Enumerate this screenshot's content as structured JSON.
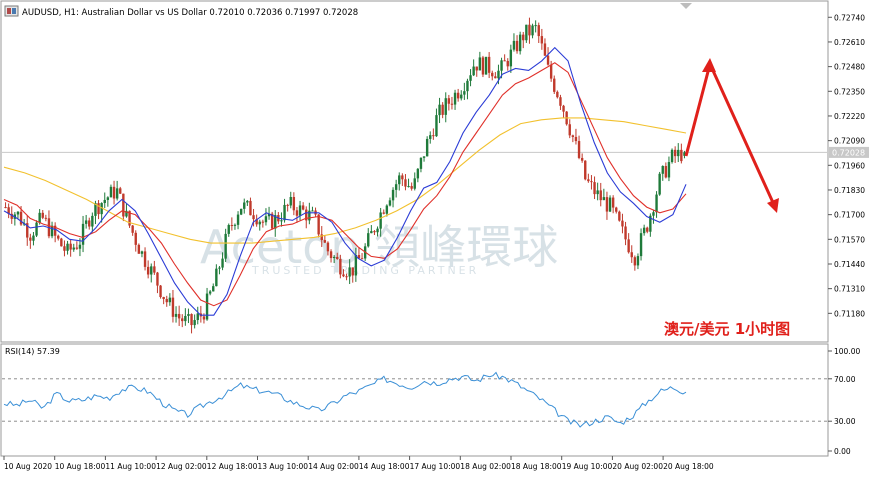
{
  "header": {
    "symbol_line": "AUDUSD, H1:  Australian Dollar vs US Dollar  0.72010 0.72036 0.71997 0.72028"
  },
  "colors": {
    "bull": "#1f7a3a",
    "bear": "#c0392b",
    "ma_fast": "#2b3cd6",
    "ma_mid": "#e0302a",
    "ma_slow": "#f2c12e",
    "rsi": "#3a8fd6",
    "arrow": "#e0201b",
    "grid": "#7f7f7f",
    "text": "#000000"
  },
  "icons": {
    "window_icon": "chart-window-icon",
    "scroll_marker": "scroll-triangle-icon"
  },
  "overlay": {
    "watermark": "Acetop 領峰環球",
    "watermark_sub": "TRUSTED TRADING PARTNER",
    "annotation": "澳元/美元 1小时图"
  },
  "chart_data": [
    {
      "type": "candlestick",
      "symbol": "AUDUSD",
      "timeframe": "H1",
      "description": "Australian Dollar vs US Dollar",
      "last_bar": {
        "open": 0.7201,
        "high": 0.72036,
        "low": 0.71997,
        "close": 0.72028
      },
      "current_price_label": "0.72028",
      "ylim": [
        0.7105,
        0.7281
      ],
      "y_ticks": [
        "0.72740",
        "0.72610",
        "0.72480",
        "0.72350",
        "0.72220",
        "0.72090",
        "0.71960",
        "0.71830",
        "0.71700",
        "0.71570",
        "0.71440",
        "0.71310",
        "0.71180"
      ],
      "x_ticks": [
        "10 Aug 2020",
        "10 Aug 18:00",
        "11 Aug 10:00",
        "12 Aug 02:00",
        "12 Aug 18:00",
        "13 Aug 10:00",
        "14 Aug 02:00",
        "14 Aug 18:00",
        "17 Aug 10:00",
        "18 Aug 02:00",
        "18 Aug 18:00",
        "19 Aug 10:00",
        "20 Aug 02:00",
        "20 Aug 18:00"
      ],
      "close_path": [
        0.7174,
        0.717,
        0.716,
        0.7168,
        0.7158,
        0.715,
        0.7156,
        0.7172,
        0.7178,
        0.7183,
        0.7165,
        0.715,
        0.7138,
        0.7125,
        0.7116,
        0.7112,
        0.7118,
        0.7135,
        0.716,
        0.7175,
        0.7172,
        0.7165,
        0.7168,
        0.7175,
        0.7172,
        0.7168,
        0.7152,
        0.7144,
        0.714,
        0.715,
        0.7165,
        0.718,
        0.719,
        0.7183,
        0.7205,
        0.7222,
        0.723,
        0.7238,
        0.725,
        0.7248,
        0.7245,
        0.7255,
        0.7265,
        0.7268,
        0.7245,
        0.723,
        0.721,
        0.7188,
        0.718,
        0.7174,
        0.716,
        0.7148,
        0.7165,
        0.7188,
        0.72,
        0.7203
      ],
      "ma_fast": [
        0.7172,
        0.7168,
        0.7163,
        0.7164,
        0.7162,
        0.7157,
        0.7156,
        0.7163,
        0.7172,
        0.7178,
        0.7172,
        0.716,
        0.7147,
        0.7134,
        0.7124,
        0.7117,
        0.7117,
        0.7128,
        0.7148,
        0.7166,
        0.7171,
        0.7168,
        0.7167,
        0.7171,
        0.7171,
        0.7166,
        0.7155,
        0.7147,
        0.7143,
        0.7146,
        0.7158,
        0.7172,
        0.7184,
        0.7187,
        0.7198,
        0.7213,
        0.7224,
        0.7233,
        0.7244,
        0.7247,
        0.7246,
        0.7251,
        0.7258,
        0.7251,
        0.7228,
        0.7208,
        0.7192,
        0.7182,
        0.7176,
        0.7169,
        0.7166,
        0.717,
        0.7186
      ],
      "ma_mid": [
        0.7178,
        0.7175,
        0.7168,
        0.7165,
        0.7163,
        0.716,
        0.7158,
        0.7161,
        0.7167,
        0.7172,
        0.717,
        0.7163,
        0.7155,
        0.7144,
        0.7134,
        0.7125,
        0.7122,
        0.7125,
        0.7138,
        0.7152,
        0.7161,
        0.7164,
        0.7165,
        0.7168,
        0.7169,
        0.7167,
        0.716,
        0.7153,
        0.7148,
        0.7147,
        0.7152,
        0.7162,
        0.7173,
        0.718,
        0.719,
        0.7203,
        0.7213,
        0.7223,
        0.7233,
        0.7239,
        0.7242,
        0.7246,
        0.725,
        0.7245,
        0.723,
        0.7215,
        0.72,
        0.7189,
        0.718,
        0.7174,
        0.7171,
        0.7173,
        0.7181
      ],
      "ma_slow": [
        0.7195,
        0.7192,
        0.7188,
        0.7183,
        0.7178,
        0.7172,
        0.7166,
        0.7163,
        0.716,
        0.7157,
        0.7155,
        0.7155,
        0.7155,
        0.7156,
        0.7157,
        0.7158,
        0.716,
        0.7163,
        0.7167,
        0.7172,
        0.7178,
        0.7186,
        0.7195,
        0.7204,
        0.7212,
        0.7218,
        0.722,
        0.7221,
        0.7221,
        0.722,
        0.7219,
        0.7217,
        0.7215,
        0.7213
      ]
    },
    {
      "type": "line",
      "name": "RSI(14)",
      "title": "RSI(14) 57.39",
      "last_value": 57.39,
      "ylim": [
        0,
        100
      ],
      "y_ticks": [
        "100.00",
        "70.00",
        "30.00",
        "0.00"
      ],
      "levels": [
        70,
        30
      ],
      "values": [
        47,
        45,
        50,
        42,
        56,
        49,
        50,
        54,
        52,
        60,
        62,
        58,
        48,
        40,
        36,
        44,
        50,
        56,
        64,
        60,
        58,
        54,
        48,
        44,
        40,
        46,
        54,
        58,
        64,
        70,
        66,
        62,
        68,
        66,
        70,
        72,
        68,
        74,
        72,
        66,
        58,
        50,
        40,
        30,
        26,
        30,
        34,
        28,
        36,
        48,
        58,
        62,
        57.39
      ]
    }
  ]
}
